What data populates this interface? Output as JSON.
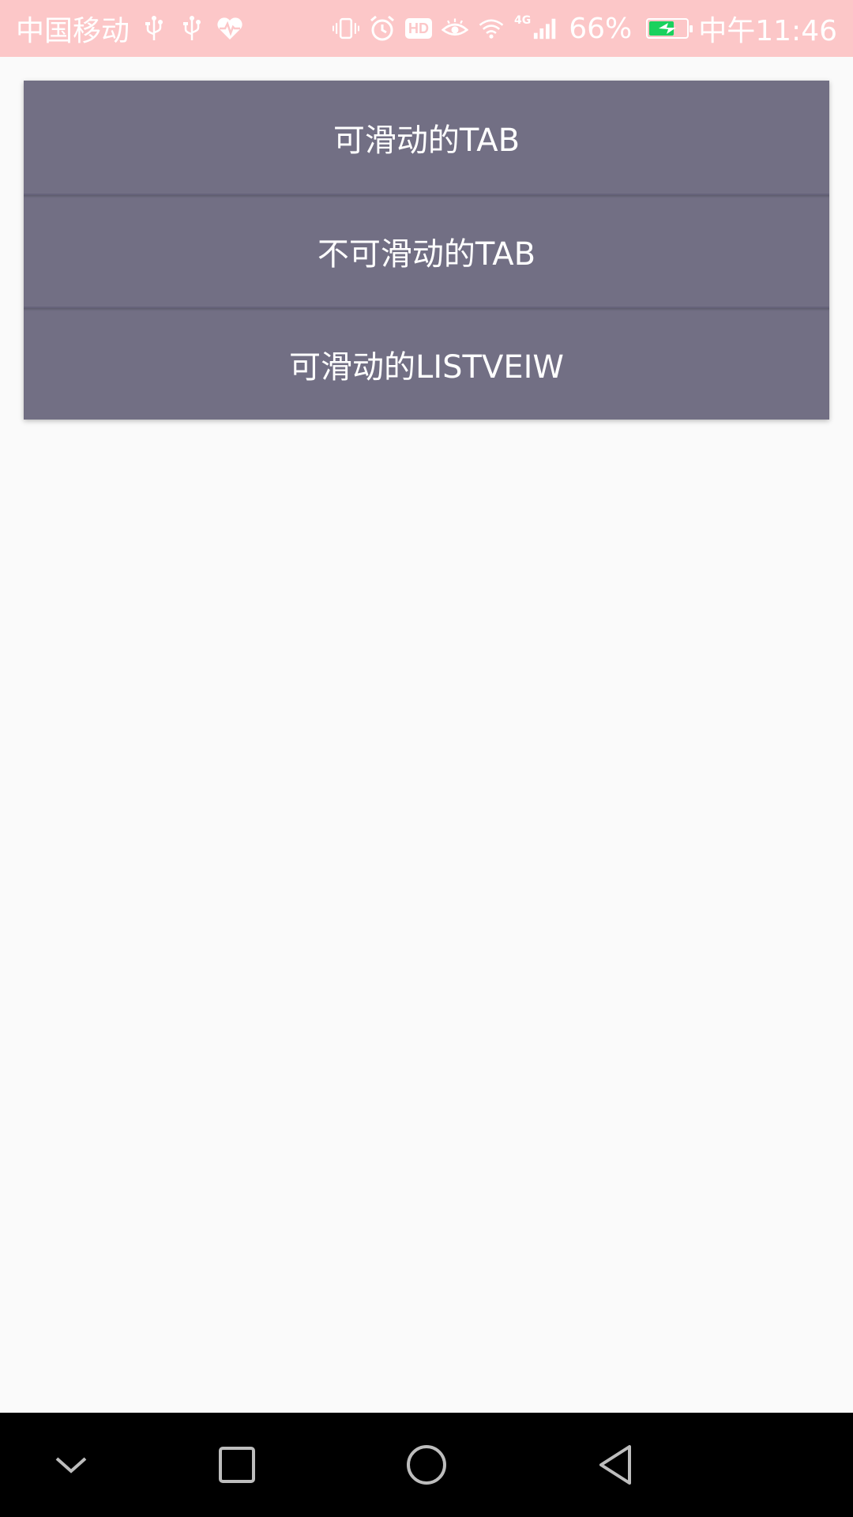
{
  "status_bar": {
    "carrier": "中国移动",
    "battery_percent": "66%",
    "battery_level": 0.66,
    "time": "中午11:46",
    "hd_badge": "HD",
    "network_type": "4G",
    "icons": [
      "usb-icon",
      "usb-icon",
      "health-icon",
      "vibrate-icon",
      "alarm-icon",
      "hd-icon",
      "eye-comfort-icon",
      "wifi-icon",
      "signal-icon",
      "battery-icon"
    ],
    "colors": {
      "background": "#fcc7c8",
      "battery_fill": "#19d15d"
    }
  },
  "menu": {
    "items": [
      {
        "label": "可滑动的TAB"
      },
      {
        "label": "不可滑动的TAB"
      },
      {
        "label": "可滑动的LISTVEIW"
      }
    ],
    "colors": {
      "button_background": "#726f84",
      "button_text": "#ffffff"
    }
  },
  "nav_bar": {
    "keys": [
      "hide-keyboard-icon",
      "recents-square-icon",
      "home-circle-icon",
      "back-triangle-icon"
    ]
  }
}
